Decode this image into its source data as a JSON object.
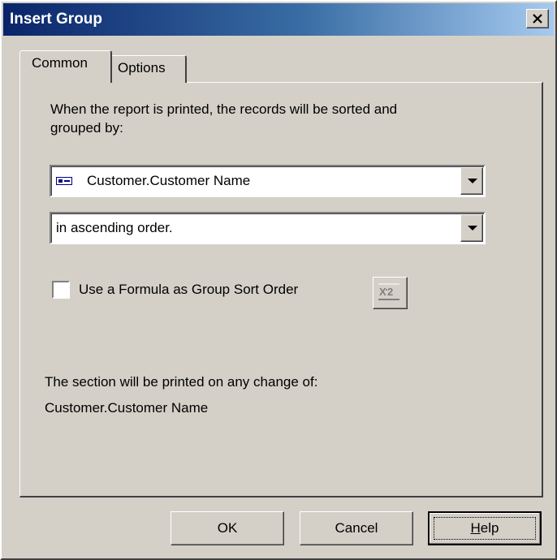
{
  "window": {
    "title": "Insert Group"
  },
  "tabs": [
    {
      "label": "Common",
      "active": true
    },
    {
      "label": "Options",
      "active": false
    }
  ],
  "main": {
    "intro_text_line1": "When the report is printed, the records will be sorted and",
    "intro_text_line2": "grouped by:",
    "group_field": {
      "icon": "database-field-icon",
      "value": "Customer.Customer Name"
    },
    "sort_order": {
      "value": "in ascending order."
    },
    "formula_checkbox": {
      "label": "Use a Formula as Group Sort Order",
      "checked": false,
      "button_icon": "formula-editor-icon"
    },
    "section_text": "The section will be printed on any change of:",
    "section_field": "Customer.Customer Name"
  },
  "buttons": {
    "ok": "OK",
    "cancel": "Cancel",
    "help_mnemonic": "H",
    "help_rest": "elp"
  },
  "colors": {
    "title_start": "#0a246a",
    "title_end": "#a6caf0",
    "face": "#d4d0c8"
  }
}
